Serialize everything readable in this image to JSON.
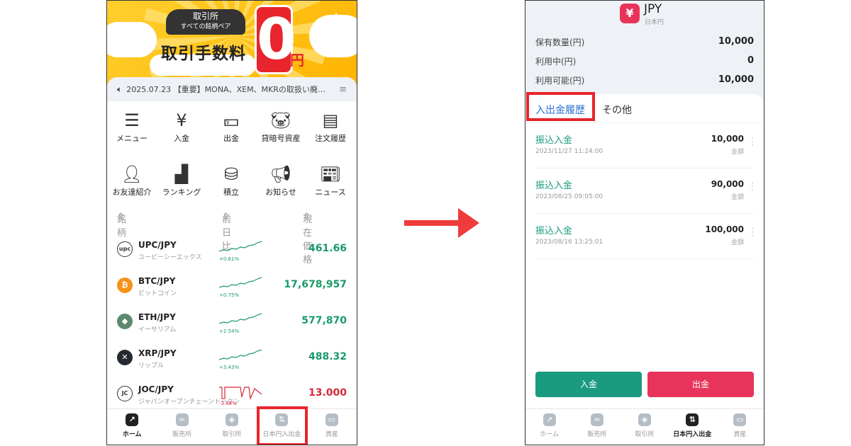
{
  "left": {
    "banner": {
      "line1": "取引所",
      "line2": "すべての銘柄ペア",
      "fee": "取引手数料",
      "zero": "0",
      "yen": "円"
    },
    "news": "2025.07.23 【重要】MONA、XEM、MKRの取扱い廃…",
    "menu": [
      {
        "label": "メニュー",
        "icon": "menu-list-icon"
      },
      {
        "label": "入金",
        "icon": "deposit-icon"
      },
      {
        "label": "出金",
        "icon": "withdraw-icon"
      },
      {
        "label": "貸暗号資産",
        "icon": "piggy-bank-icon"
      },
      {
        "label": "注文履歴",
        "icon": "order-history-icon"
      },
      {
        "label": "お友達紹介",
        "icon": "friend-referral-icon"
      },
      {
        "label": "ランキング",
        "icon": "ranking-icon"
      },
      {
        "label": "積立",
        "icon": "coins-icon"
      },
      {
        "label": "お知らせ",
        "icon": "megaphone-icon"
      },
      {
        "label": "ニュース",
        "icon": "news-icon"
      }
    ],
    "list_header": {
      "name": "銘柄",
      "change": "前日比",
      "price": "現在価格"
    },
    "coins": [
      {
        "pair": "UPC/JPY",
        "jp": "ユーピーシーエックス",
        "pct": "+0.61%",
        "price": "461.66",
        "icon": "upc",
        "color": "#ffffff"
      },
      {
        "pair": "BTC/JPY",
        "jp": "ビットコイン",
        "pct": "+0.75%",
        "price": "17,678,957",
        "icon": "₿",
        "color": "#f7931a"
      },
      {
        "pair": "ETH/JPY",
        "jp": "イーサリアム",
        "pct": "+2.54%",
        "price": "577,870",
        "icon": "◆",
        "color": "#5d8a6e"
      },
      {
        "pair": "XRP/JPY",
        "jp": "リップル",
        "pct": "+3.43%",
        "price": "488.32",
        "icon": "✕",
        "color": "#23292f"
      },
      {
        "pair": "JOC/JPY",
        "jp": "ジャパンオープンチェーントークン",
        "pct": "-3.68%",
        "price": "13.000",
        "icon": "JC",
        "color": "#ffffff"
      }
    ],
    "nav": [
      {
        "label": "ホーム",
        "icon": "home-chart-icon",
        "active": true
      },
      {
        "label": "販売所",
        "icon": "exchange-icon",
        "active": false
      },
      {
        "label": "取引所",
        "icon": "trade-icon",
        "active": false
      },
      {
        "label": "日本円入出金",
        "icon": "transfer-icon",
        "active": false
      },
      {
        "label": "資産",
        "icon": "wallet-icon",
        "active": false
      }
    ]
  },
  "right": {
    "currency": "JPY",
    "currency_sub": "日本円",
    "currency_icon": "¥",
    "balances": [
      {
        "label": "保有数量(円)",
        "value": "10,000"
      },
      {
        "label": "利用中(円)",
        "value": "0"
      },
      {
        "label": "利用可能(円)",
        "value": "10,000"
      }
    ],
    "tabs": [
      "入出金履歴",
      "その他"
    ],
    "history": [
      {
        "type": "振込入金",
        "date": "2023/11/27 11:24:00",
        "amount": "10,000",
        "amount_label": "金額"
      },
      {
        "type": "振込入金",
        "date": "2023/08/25 09:05:00",
        "amount": "90,000",
        "amount_label": "金額"
      },
      {
        "type": "振込入金",
        "date": "2023/08/16 13:25:01",
        "amount": "100,000",
        "amount_label": "金額"
      }
    ],
    "deposit_btn": "入金",
    "withdraw_btn": "出金",
    "nav": [
      {
        "label": "ホーム",
        "icon": "home-chart-icon",
        "active": false
      },
      {
        "label": "販売所",
        "icon": "exchange-icon",
        "active": false
      },
      {
        "label": "取引所",
        "icon": "trade-icon",
        "active": false
      },
      {
        "label": "日本円入出金",
        "icon": "transfer-icon",
        "active": true
      },
      {
        "label": "資産",
        "icon": "wallet-icon",
        "active": false
      }
    ]
  },
  "colors": {
    "green": "#1a9a7f",
    "red": "#e8345a",
    "highlight": "#e8242c",
    "up": "#1a9a6a",
    "down": "#d6283a"
  }
}
